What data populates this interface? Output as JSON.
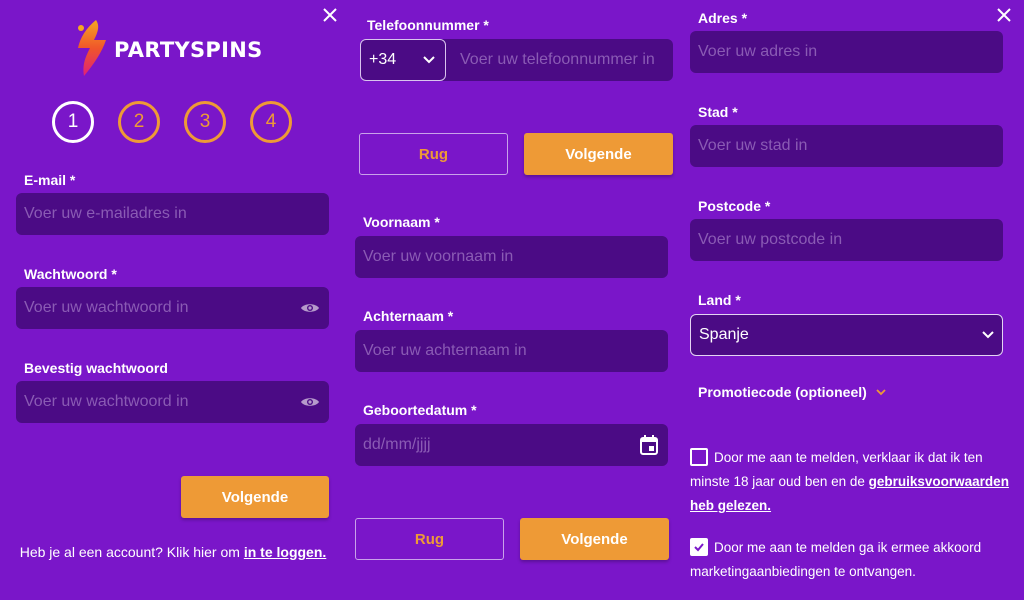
{
  "brand": {
    "logo_text": "PARTYSPINS",
    "accent": "#ee9a36",
    "background": "#7a16c9",
    "field_bg": "#4b0b85"
  },
  "steps": [
    "1",
    "2",
    "3",
    "4"
  ],
  "active_step": 1,
  "step1": {
    "email_label": "E-mail *",
    "email_placeholder": "Voer uw e-mailadres in",
    "password_label": "Wachtwoord *",
    "password_placeholder": "Voer uw wachtwoord in",
    "confirm_label": "Bevestig wachtwoord",
    "confirm_placeholder": "Voer uw wachtwoord in",
    "next_label": "Volgende",
    "login_prompt": "Heb je al een account? Klik hier om",
    "login_link": "in te loggen."
  },
  "step2": {
    "phone_label": "Telefoonnummer *",
    "phone_prefix": "+34",
    "phone_placeholder": "Voer uw telefoonnummer in",
    "back_label": "Rug",
    "next_label": "Volgende"
  },
  "step3": {
    "firstname_label": "Voornaam *",
    "firstname_placeholder": "Voer uw voornaam in",
    "lastname_label": "Achternaam *",
    "lastname_placeholder": "Voer uw achternaam in",
    "birthdate_label": "Geboortedatum *",
    "birthdate_placeholder": "dd/mm/jjjj",
    "back_label": "Rug",
    "next_label": "Volgende"
  },
  "step4": {
    "address_label": "Adres *",
    "address_placeholder": "Voer uw adres in",
    "city_label": "Stad *",
    "city_placeholder": "Voer uw stad in",
    "postcode_label": "Postcode *",
    "postcode_placeholder": "Voer uw postcode in",
    "country_label": "Land *",
    "country_value": "Spanje",
    "promo_label": "Promotiecode (optioneel)",
    "terms_text": "Door me aan te melden, verklaar ik dat ik ten minste 18 jaar oud ben en de",
    "terms_link": "gebruiksvoorwaarden heb gelezen.",
    "terms_checked": false,
    "marketing_text": "Door me aan te melden ga ik ermee akkoord marketingaanbiedingen te ontvangen.",
    "marketing_checked": true
  }
}
